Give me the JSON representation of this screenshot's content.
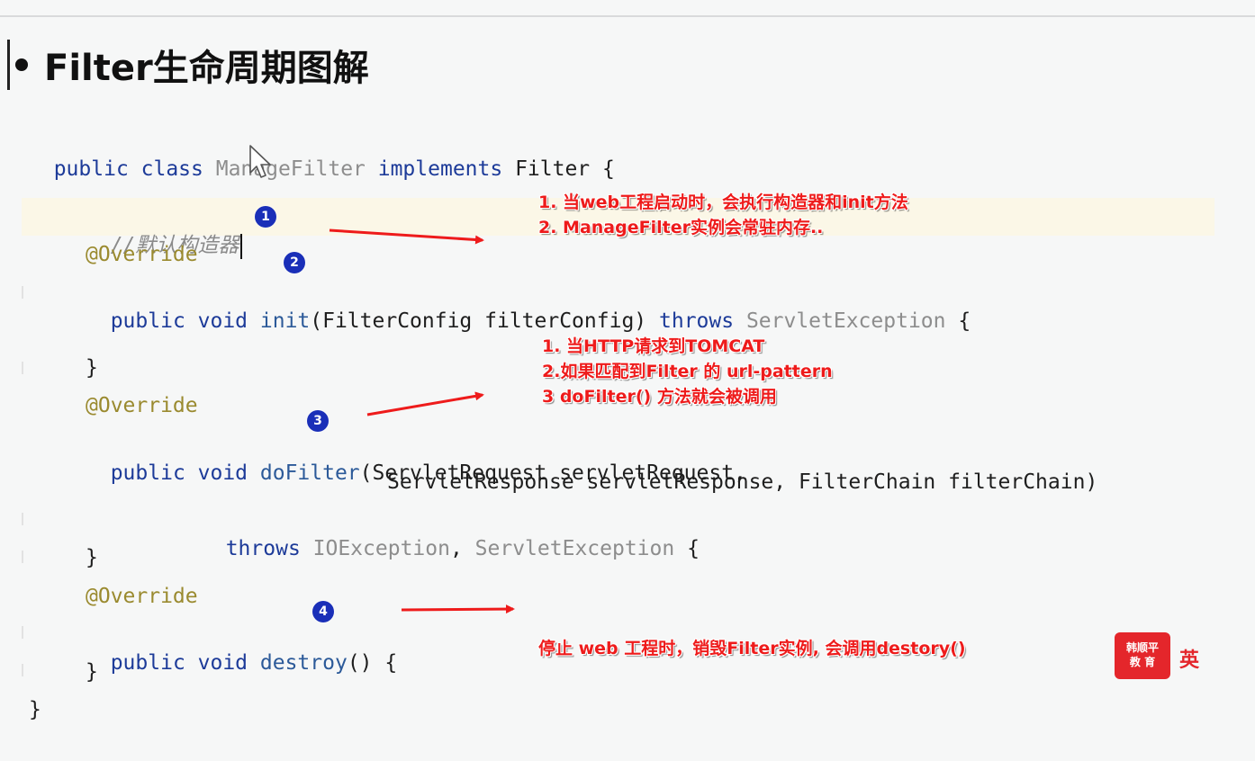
{
  "slide": {
    "title": "Filter生命周期图解"
  },
  "code": {
    "l1": {
      "a": "public class ",
      "b": "ManageFilter",
      "c": " implements ",
      "d": "Filter {"
    },
    "comment": "//默认构造器",
    "override1": "@Override",
    "l4": {
      "a": "public void ",
      "b": "init",
      "c": "(FilterConfig filterConfig) ",
      "d": "throws ",
      "e": "ServletException",
      "f": " {"
    },
    "close1": "}",
    "override2": "@Override",
    "l7": {
      "a": "public void ",
      "b": "doFilter",
      "c": "(ServletRequest servletRequest,"
    },
    "l8": "ServletResponse servletResponse, FilterChain filterChain)",
    "l9": {
      "a": "throws ",
      "b": "IOException",
      "c": ", ",
      "d": "ServletException",
      "e": " {"
    },
    "close2": "}",
    "override3": "@Override",
    "l12": {
      "a": "public void ",
      "b": "destroy",
      "c": "() {"
    },
    "close3": "}",
    "close4": "}"
  },
  "badges": [
    "1",
    "2",
    "3",
    "4"
  ],
  "notes": {
    "init": [
      "1. 当web工程启动时，会执行构造器和init方法",
      "2. ManageFilter实例会常驻内存.."
    ],
    "dofilter": [
      "1. 当HTTP请求到TOMCAT",
      "2.如果匹配到Filter 的 url-pattern",
      "3 doFilter() 方法就会被调用"
    ],
    "destroy": "停止 web 工程时，销毁Filter实例, 会调用destory()"
  },
  "logo": {
    "line1": "韩顺平",
    "line2": "教 育",
    "side": "英"
  },
  "colors": {
    "keyword": "#1d3b99",
    "annotation": "#9a8a2f",
    "note": "#ee1b1b",
    "badge": "#1a2fb8"
  },
  "icons": [
    "mouse-cursor-icon",
    "arrow-icon"
  ]
}
